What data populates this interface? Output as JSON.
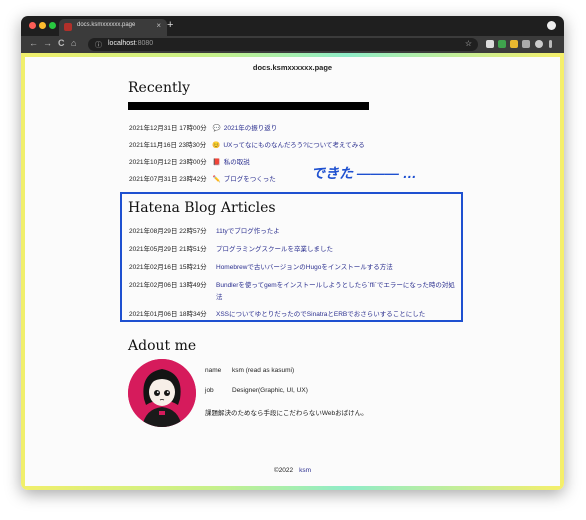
{
  "browser": {
    "tab_title": "docs.ksmxxxxxx.page",
    "tab_close": "×",
    "new_tab": "+",
    "back": "←",
    "forward": "→",
    "reload": "C",
    "home": "⌂",
    "url_host": "localhost",
    "url_port": ":8080",
    "bookmark": "☆"
  },
  "site": {
    "title": "docs.ksmxxxxxx.page"
  },
  "recently": {
    "heading": "Recently",
    "items": [
      {
        "date": "2021年12月31日 17時00分",
        "icon": "💬",
        "title": "2021年の振り返り"
      },
      {
        "date": "2021年11月16日 23時30分",
        "icon": "😊",
        "title": "UXってなにものなんだろう?について考えてみる"
      },
      {
        "date": "2021年10月12日 23時00分",
        "icon": "📕",
        "title": "私の取説"
      },
      {
        "date": "2021年07月31日 23時42分",
        "icon": "✏️",
        "title": "ブログをつくった"
      }
    ]
  },
  "annotation": {
    "text": "できた ——— …"
  },
  "hatena": {
    "heading": "Hatena Blog Articles",
    "items": [
      {
        "date": "2021年08月29日 22時57分",
        "title": "11tyでブログ作ったよ"
      },
      {
        "date": "2021年05月29日 21時51分",
        "title": "プログラミングスクールを卒業しました"
      },
      {
        "date": "2021年02月16日 15時21分",
        "title": "Homebrewで古いバージョンのHugoをインストールする方法"
      },
      {
        "date": "2021年02月06日 13時49分",
        "title": "Bundlerを使ってgemをインストールしようとしたら`ffi`でエラーになった時の対処",
        "title2": "法"
      },
      {
        "date": "2021年01月06日 18時34分",
        "title": "XSSについてゆとりだったのでSinatraとERBでおさらいすることにした"
      }
    ]
  },
  "about": {
    "heading": "Adout me",
    "name_label": "name",
    "name_value": "ksm (read as kasumi)",
    "job_label": "job",
    "job_value": "Designer(Graphic, UI, UX)",
    "bio": "課題解決のためなら手段にこだわらないWebおばけん。"
  },
  "footer": {
    "copyright": "©2022",
    "author": "ksm"
  },
  "colors": {
    "link": "#2b2f8f",
    "annotation_blue": "#1e50d0",
    "avatar_bg": "#d61b5c"
  }
}
